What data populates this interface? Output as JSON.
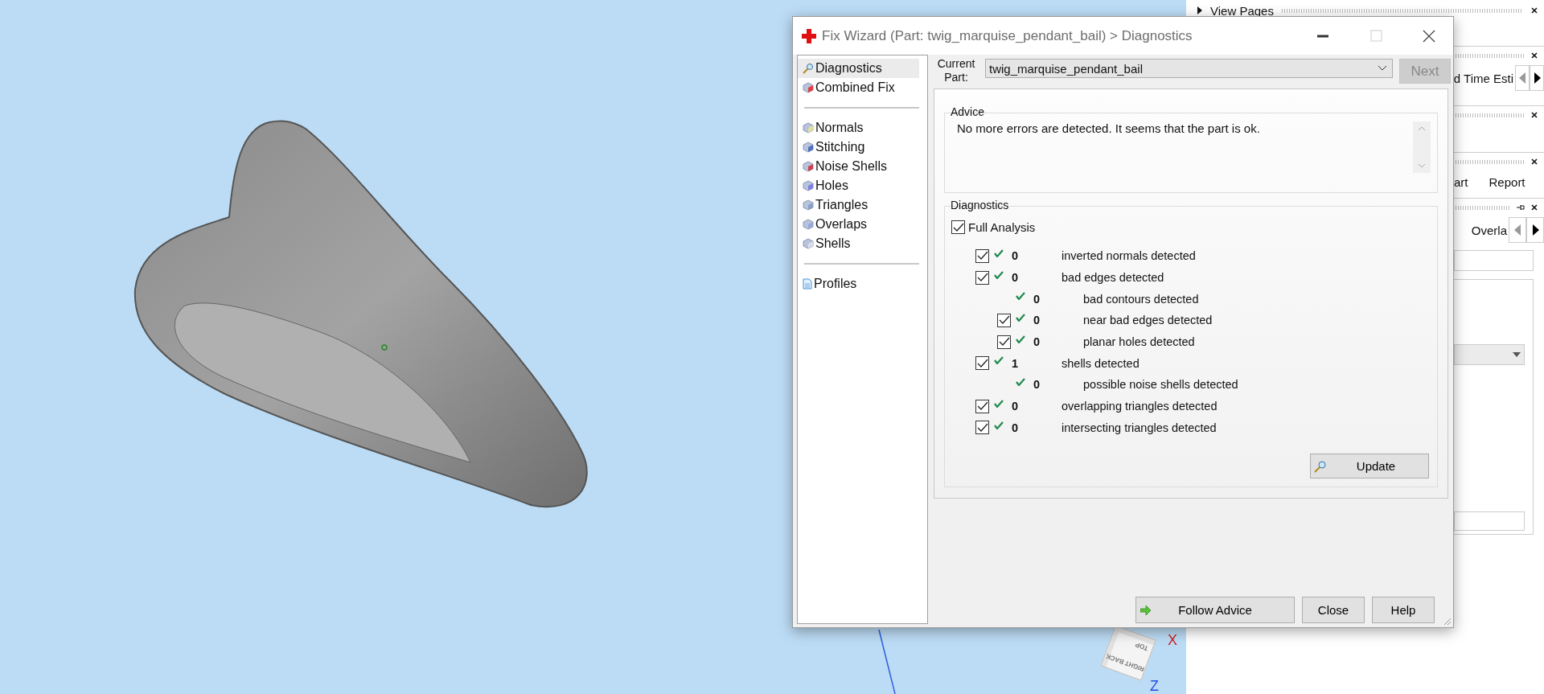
{
  "viewport": {
    "axis_labels": [
      {
        "text": "X",
        "color": "#d02020"
      },
      {
        "text": "Z",
        "color": "#2050e0"
      }
    ],
    "view_cube": [
      "RIGHT",
      "BACK",
      "TOP"
    ]
  },
  "side_panel": {
    "rows": [
      {
        "kind": "expander",
        "label": "View Pages"
      },
      {
        "kind": "tabstrip",
        "label": "d Time Esti"
      },
      {
        "kind": "empty"
      },
      {
        "kind": "tabs",
        "tabs": [
          "art",
          "Report"
        ]
      },
      {
        "kind": "tabstrip",
        "label": "Overla",
        "pinned": true
      }
    ]
  },
  "dialog": {
    "title": "Fix Wizard (Part: twig_marquise_pendant_bail) > Diagnostics",
    "nav_groups": [
      [
        {
          "label": "Diagnostics",
          "kind": "diagnose",
          "selected": true
        },
        {
          "label": "Combined Fix",
          "kind": "fix",
          "selected": false
        }
      ],
      [
        {
          "label": "Normals",
          "kind": "fix",
          "selected": false
        },
        {
          "label": "Stitching",
          "kind": "fix",
          "selected": false
        },
        {
          "label": "Noise Shells",
          "kind": "fix",
          "selected": false
        },
        {
          "label": "Holes",
          "kind": "fix",
          "selected": false
        },
        {
          "label": "Triangles",
          "kind": "fix",
          "selected": false
        },
        {
          "label": "Overlaps",
          "kind": "fix",
          "selected": false
        },
        {
          "label": "Shells",
          "kind": "fix",
          "selected": false
        }
      ],
      [
        {
          "label": "Profiles",
          "kind": "document",
          "selected": false
        }
      ]
    ],
    "current_part_label": "Current Part:",
    "current_part": "twig_marquise_pendant_bail",
    "next_button": {
      "label": "Next",
      "disabled": true
    },
    "advice": {
      "heading": "Advice",
      "text": "No more errors are detected. It seems that the part is ok."
    },
    "diagnostics": {
      "heading": "Diagnostics",
      "full_analysis": {
        "label": "Full Analysis",
        "checked": true
      },
      "checks": [
        {
          "kind": "check",
          "checked": true,
          "passed": true,
          "count": "0",
          "label": "inverted normals detected"
        },
        {
          "kind": "check",
          "checked": true,
          "passed": true,
          "count": "0",
          "label": "bad edges detected",
          "children": [
            {
              "kind": "info",
              "passed": true,
              "count": "0",
              "label": "bad contours detected"
            },
            {
              "kind": "check",
              "checked": true,
              "passed": true,
              "count": "0",
              "label": "near bad edges detected"
            },
            {
              "kind": "check",
              "checked": true,
              "passed": true,
              "count": "0",
              "label": "planar holes detected"
            }
          ]
        },
        {
          "kind": "check",
          "checked": true,
          "passed": true,
          "count": "1",
          "label": "shells detected",
          "children": [
            {
              "kind": "info",
              "passed": true,
              "count": "0",
              "label": "possible noise shells detected"
            }
          ]
        },
        {
          "kind": "check",
          "checked": true,
          "passed": true,
          "count": "0",
          "label": "overlapping triangles detected"
        },
        {
          "kind": "check",
          "checked": true,
          "passed": true,
          "count": "0",
          "label": "intersecting triangles detected"
        }
      ],
      "update_button": "Update"
    },
    "buttons": [
      {
        "kind": "follow",
        "label": "Follow Advice"
      },
      {
        "kind": "plain",
        "label": "Close"
      },
      {
        "kind": "plain",
        "label": "Help"
      }
    ]
  }
}
